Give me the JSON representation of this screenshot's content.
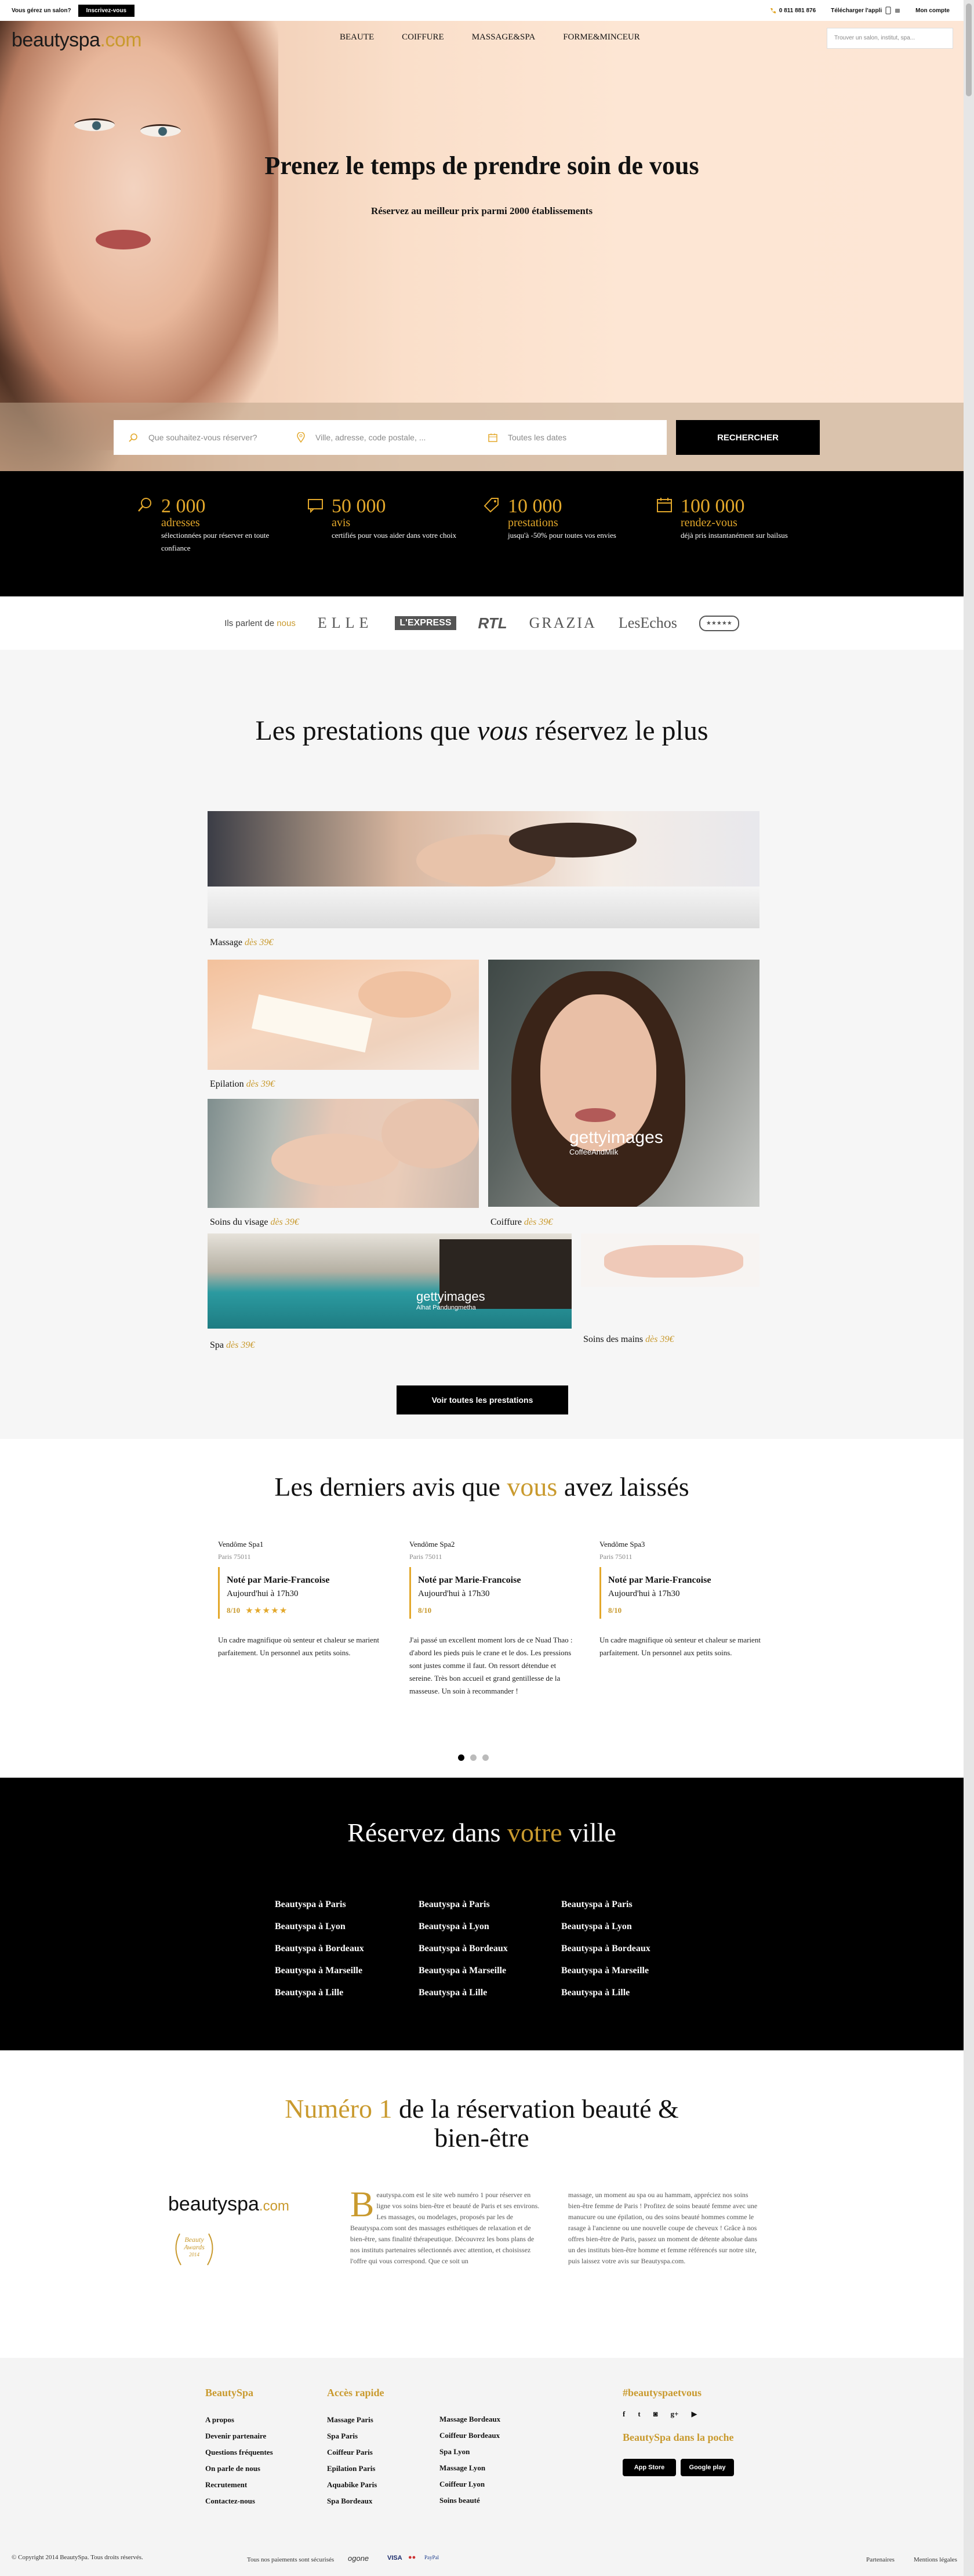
{
  "topbar": {
    "pro_question": "Vous gérez un salon?",
    "signup_label": "Inscrivez-vous",
    "phone": "0 811 881 876",
    "app_label": "Télécharger l'appli",
    "account_label": "Mon compte"
  },
  "hero": {
    "logo_main": "beautyspa",
    "logo_suffix": ".com",
    "nav": [
      "BEAUTE",
      "COIFFURE",
      "MASSAGE&SPA",
      "FORME&MINCEUR"
    ],
    "search_placeholder": "Trouver un salon, institut, spa...",
    "title": "Prenez le temps de prendre soin de vous",
    "subtitle": "Réservez au meilleur prix parmi 2000 établissements",
    "what_placeholder": "Que souhaitez-vous réserver?",
    "where_placeholder": "Ville, adresse, code postale, ...",
    "when_placeholder": "Toutes les dates",
    "search_button": "RECHERCHER"
  },
  "stats": [
    {
      "num": "2 000",
      "unit": "adresses",
      "desc": "sélectionnées pour réserver en toute confiance"
    },
    {
      "num": "50 000",
      "unit": "avis",
      "desc": "certifiés pour vous aider dans votre choix"
    },
    {
      "num": "10 000",
      "unit": "prestations",
      "desc": "jusqu'à -50% pour toutes vos envies"
    },
    {
      "num": "100 000",
      "unit": "rendez-vous",
      "desc": "déjà pris instantanément sur bailsus"
    }
  ],
  "press": {
    "label_pre": "Ils parlent de",
    "label_highlight": "nous",
    "logos": [
      "ELLE",
      "L'EXPRESS",
      "RTL",
      "GRAZIA",
      "LesEchos",
      "★★★★★"
    ]
  },
  "prestations": {
    "title_pre": "Les prestations que",
    "title_em": "vous",
    "title_post": "réservez le plus",
    "items": [
      {
        "name": "Massage",
        "price": "dès 39€"
      },
      {
        "name": "Epilation",
        "price": "dès 39€"
      },
      {
        "name": "Soins du visage",
        "price": "dès 39€"
      },
      {
        "name": "Coiffure",
        "price": "dès 39€"
      },
      {
        "name": "Spa",
        "price": "dès 39€"
      },
      {
        "name": "Soins des mains",
        "price": "dès 39€"
      }
    ],
    "watermark1": "gettyimages",
    "watermark1_sub": "CoffeeAndMilk",
    "watermark2": "gettyimages",
    "watermark2_sub": "Alhat Pandungmetha",
    "see_all": "Voir toutes les prestations"
  },
  "reviews": {
    "title_pre": "Les derniers avis que",
    "title_highlight": "vous",
    "title_post": "avez laissés",
    "items": [
      {
        "spa": "Vendôme Spa1",
        "city": "Paris 75011",
        "by": "Noté par Marie-Francoise",
        "date": "Aujourd'hui à 17h30",
        "score": "8/10",
        "text": "Un cadre magnifique où senteur et chaleur se marient parfaitement. Un personnel aux petits soins."
      },
      {
        "spa": "Vendôme Spa2",
        "city": "Paris 75011",
        "by": "Noté par Marie-Francoise",
        "date": "Aujourd'hui à 17h30",
        "score": "8/10",
        "text": "J'ai passé un excellent moment lors de ce Nuad Thao : d'abord les pieds puis le crane et le dos. Les pressions sont justes comme il faut. On ressort détendue et sereine. Très bon accueil et grand gentillesse de la masseuse. Un soin à recommander !"
      },
      {
        "spa": "Vendôme Spa3",
        "city": "Paris 75011",
        "by": "Noté par Marie-Francoise",
        "date": "Aujourd'hui à 17h30",
        "score": "8/10",
        "text": "Un cadre magnifique où senteur et chaleur se marient parfaitement. Un personnel aux petits soins."
      }
    ]
  },
  "cities": {
    "title_pre": "Réservez dans",
    "title_highlight": "votre",
    "title_post": "ville",
    "columns": [
      [
        "Beautyspa à Paris",
        "Beautyspa à Lyon",
        "Beautyspa à Bordeaux",
        "Beautyspa à Marseille",
        "Beautyspa à Lille"
      ],
      [
        "Beautyspa à Paris",
        "Beautyspa à Lyon",
        "Beautyspa à Bordeaux",
        "Beautyspa à Marseille",
        "Beautyspa à Lille"
      ],
      [
        "Beautyspa à Paris",
        "Beautyspa à Lyon",
        "Beautyspa à Bordeaux",
        "Beautyspa à Marseille",
        "Beautyspa à Lille"
      ]
    ]
  },
  "numero": {
    "title_highlight": "Numéro 1",
    "title_rest": "de la réservation beauté &",
    "title_line2": "bien-être",
    "logo_main": "beautyspa",
    "logo_suffix": ".com",
    "award_line1": "Beauty",
    "award_line2": "Awards",
    "award_year": "2014",
    "dropcap": "B",
    "col1": "eautyspa.com est le site web numéro 1 pour réserver en ligne vos soins bien-être et beauté de Paris et ses environs. Les massages, ou modelages, proposés par les de Beautyspa.com sont des massages esthétiques de relaxation et de bien-être, sans finalité thérapeutique. Découvrez les bons plans de nos instituts partenaires sélectionnés avec attention, et choisissez l'offre qui vous correspond. Que ce soit un",
    "col2": "massage, un moment au spa ou au hammam, appréciez nos soins bien-être femme de Paris ! Profitez de soins beauté femme avec une manucure ou une épilation, ou des soins beauté hommes comme le rasage à l'ancienne ou une nouvelle coupe de cheveux ! Grâce à nos offres bien-être de Paris, passez un moment de détente absolue dans un des instituts bien-être homme et femme référencés sur notre site, puis laissez votre avis sur Beautyspa.com."
  },
  "footer": {
    "col1_title": "BeautySpa",
    "col1": [
      "A propos",
      "Devenir partenaire",
      "Questions fréquentes",
      "On parle de nous",
      "Recrutement",
      "Contactez-nous"
    ],
    "col2_title": "Accès rapide",
    "col2a": [
      "Massage Paris",
      "Spa Paris",
      "Coiffeur Paris",
      "Epilation Paris",
      "Aquabike Paris",
      "Spa Bordeaux"
    ],
    "col2b": [
      "Massage Bordeaux",
      "Coiffeur Bordeaux",
      "Spa Lyon",
      "Massage Lyon",
      "Coiffeur Lyon",
      "Soins beauté"
    ],
    "hashtag": "#beautyspaetvous",
    "social": [
      "f",
      "t",
      "◙",
      "g+",
      "▶"
    ],
    "pocket_title": "BeautySpa dans la poche",
    "appstore": "App Store",
    "googleplay": "Google play",
    "copyright": "© Copyright 2014 BeautySpa. Tous droits réservés.",
    "payments_label": "Tous nos paiements sont sécurisés",
    "payments": [
      "ogone",
      "VISA",
      "●●",
      "PayPal"
    ],
    "links": [
      "Partenaires",
      "Mentions légales"
    ]
  }
}
